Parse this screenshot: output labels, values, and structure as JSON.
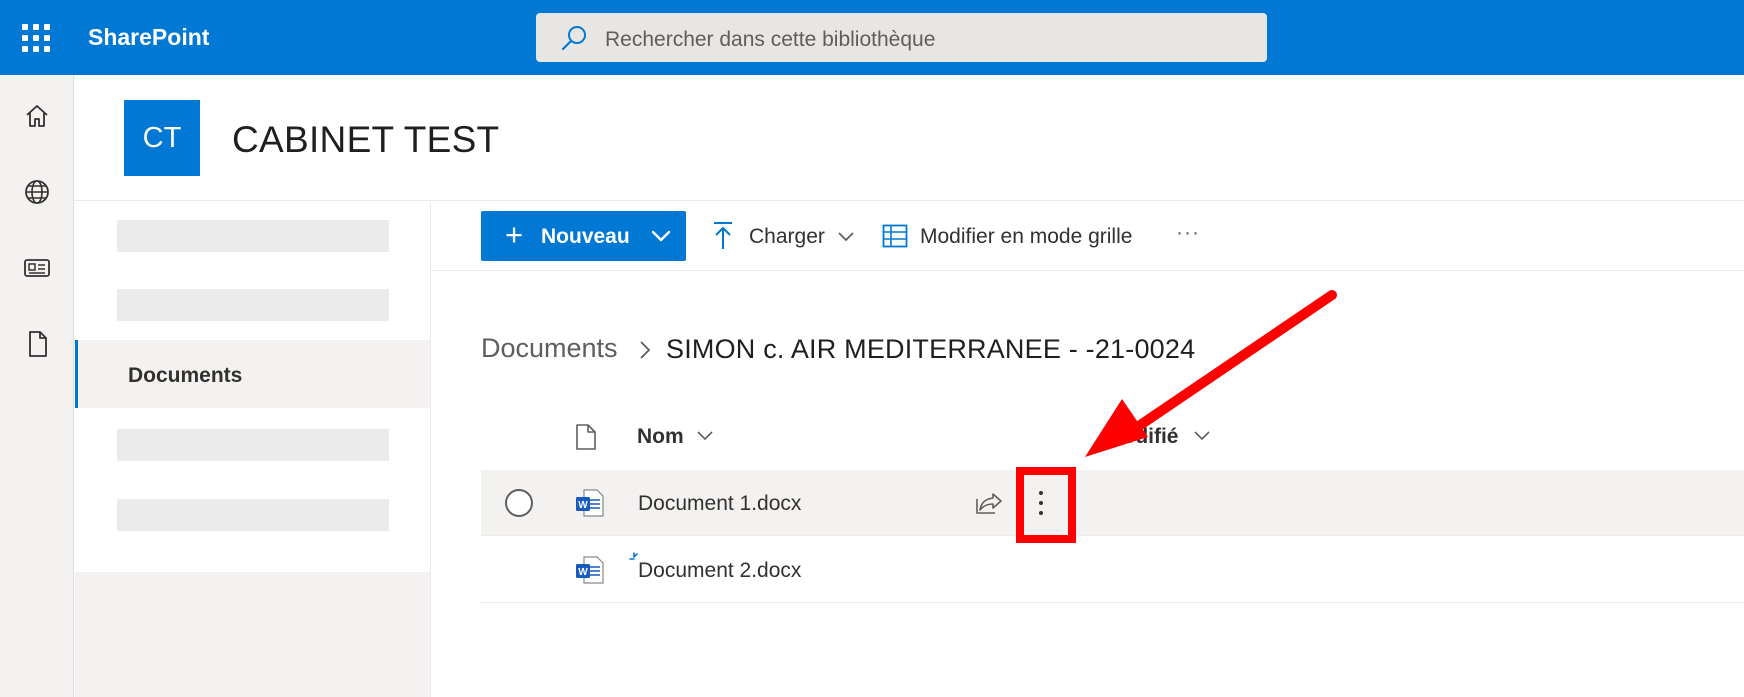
{
  "suitebar": {
    "app_name": "SharePoint",
    "search_placeholder": "Rechercher dans cette bibliothèque"
  },
  "site": {
    "logo_initials": "CT",
    "title": "CABINET TEST"
  },
  "nav": {
    "active_item": "Documents"
  },
  "commandbar": {
    "new_label": "Nouveau",
    "upload_label": "Charger",
    "grid_label": "Modifier en mode grille",
    "more_label": "···"
  },
  "breadcrumb": {
    "root": "Documents",
    "current": "SIMON c. AIR MEDITERRANEE - -21-0024"
  },
  "list": {
    "columns": {
      "name": "Nom",
      "modified": "Modifié"
    },
    "rows": [
      {
        "name": "Document 1.docx",
        "type": "word-doc-icon"
      },
      {
        "name": "Document 2.docx",
        "type": "word-doc-icon",
        "is_new": true
      }
    ]
  },
  "colors": {
    "brand": "#0078d4",
    "annotation": "#ff0000"
  }
}
